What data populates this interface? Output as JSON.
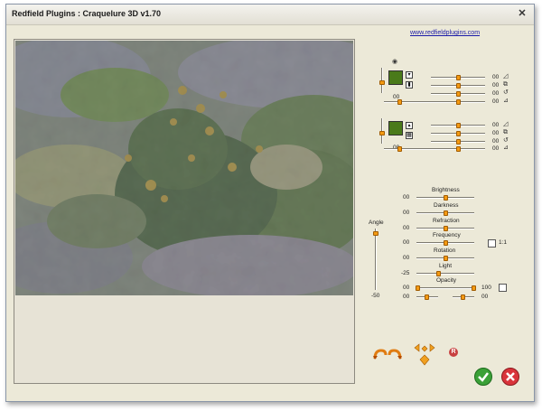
{
  "window": {
    "title": "Redfield Plugins : Craquelure 3D  v1.70"
  },
  "link": "www.redfieldplugins.com",
  "layers": [
    {
      "thumb_value": 0.5,
      "rows": [
        {
          "value": "00",
          "level": 0.67
        },
        {
          "value": "00",
          "level": 0.67
        },
        {
          "value": "00",
          "level": 0.67
        },
        {
          "value": "00",
          "level": 0.67
        }
      ],
      "left_value": "00"
    },
    {
      "thumb_value": 0.5,
      "rows": [
        {
          "value": "00",
          "level": 0.67
        },
        {
          "value": "00",
          "level": 0.67
        },
        {
          "value": "00",
          "level": 0.67
        },
        {
          "value": "00",
          "level": 0.67
        }
      ],
      "left_value": "00"
    }
  ],
  "angle": {
    "label": "Angle",
    "value": "-50",
    "level": 0.95
  },
  "params": [
    {
      "label": "Brightness",
      "value": "00",
      "level": 0.5
    },
    {
      "label": "Darkness",
      "value": "00",
      "level": 0.5
    },
    {
      "label": "Refraction",
      "value": "00",
      "level": 0.5
    },
    {
      "label": "Frequency",
      "value": "00",
      "level": 0.5
    },
    {
      "label": "Rotation",
      "value": "00",
      "level": 0.5
    },
    {
      "label": "Light",
      "value": "-25",
      "level": 0.38
    }
  ],
  "frequency_lock_label": "1:1",
  "opacity": {
    "label": "Opacity",
    "left_value": "00",
    "right_value": "100",
    "left_level": 0.0,
    "right_level": 1.0
  },
  "bottom_row": {
    "left_value": "00",
    "right_value": "00",
    "left_level": 0.5,
    "right_level": 0.5
  },
  "icons": {
    "eye": "eye-icon",
    "undo": "undo-arrow-icon",
    "redo": "redo-arrow-icon",
    "nav": "direction-pad-icon",
    "reset": "reset-icon",
    "ok": "checkmark-icon",
    "cancel": "close-icon"
  },
  "colors": {
    "ok": "#3aa037",
    "cancel": "#d9343b",
    "slider_thumb": "#f39a12"
  }
}
